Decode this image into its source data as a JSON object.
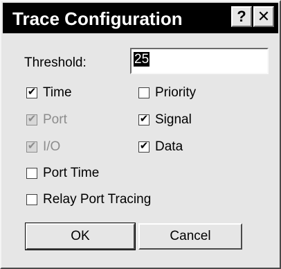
{
  "window": {
    "title": "Trace Configuration",
    "help_glyph": "?",
    "close_glyph": "✕"
  },
  "threshold": {
    "label": "Threshold:",
    "value": "25"
  },
  "checkboxes": {
    "time": {
      "label": "Time",
      "checked": true,
      "enabled": true
    },
    "port": {
      "label": "Port",
      "checked": true,
      "enabled": false
    },
    "io": {
      "label": "I/O",
      "checked": true,
      "enabled": false
    },
    "port_time": {
      "label": "Port Time",
      "checked": false,
      "enabled": true
    },
    "relay_port_tracing": {
      "label": "Relay Port Tracing",
      "checked": false,
      "enabled": true
    },
    "priority": {
      "label": "Priority",
      "checked": false,
      "enabled": true
    },
    "signal": {
      "label": "Signal",
      "checked": true,
      "enabled": true
    },
    "data": {
      "label": "Data",
      "checked": true,
      "enabled": true
    }
  },
  "buttons": {
    "ok": "OK",
    "cancel": "Cancel"
  },
  "check_glyph": "✔"
}
